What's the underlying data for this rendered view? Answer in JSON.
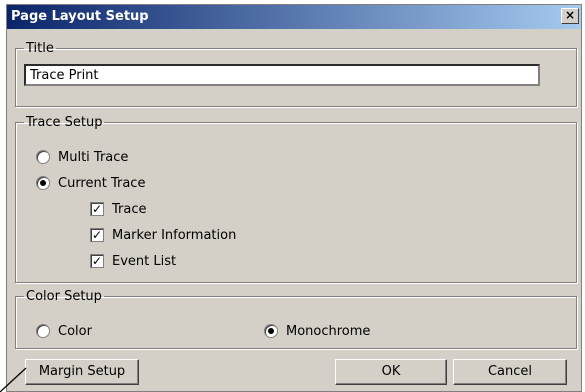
{
  "window": {
    "title": "Page Layout Setup",
    "close_glyph": "×"
  },
  "title_group": {
    "label": "Title",
    "value": "Trace Print"
  },
  "trace_setup": {
    "label": "Trace Setup",
    "options": [
      {
        "label": "Multi Trace",
        "selected": false
      },
      {
        "label": "Current Trace",
        "selected": true
      }
    ],
    "checks": [
      {
        "label": "Trace",
        "checked": true
      },
      {
        "label": "Marker Information",
        "checked": true
      },
      {
        "label": "Event List",
        "checked": true
      }
    ]
  },
  "color_setup": {
    "label": "Color Setup",
    "options": [
      {
        "label": "Color",
        "selected": false
      },
      {
        "label": "Monochrome",
        "selected": true
      }
    ]
  },
  "buttons": {
    "margin": "Margin Setup",
    "ok": "OK",
    "cancel": "Cancel"
  },
  "check_glyph": "✓"
}
